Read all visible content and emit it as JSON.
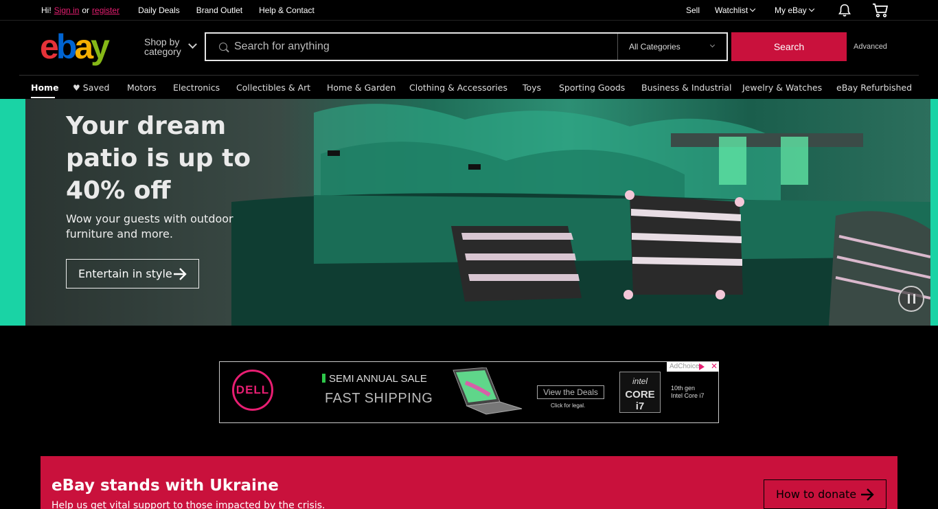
{
  "topbar": {
    "greeting": "Hi!",
    "sign_in": "Sign in",
    "or": "or",
    "register": "register",
    "links": [
      "Daily Deals",
      "Brand Outlet",
      "Help & Contact"
    ],
    "sell": "Sell",
    "watchlist": "Watchlist",
    "my_ebay": "My eBay",
    "notification_icon": "bell-icon",
    "cart_icon": "cart-icon"
  },
  "header": {
    "logo": {
      "e": "e",
      "b": "b",
      "a": "a",
      "y": "y"
    },
    "shop_by_line1": "Shop by",
    "shop_by_line2": "category",
    "search_placeholder": "Search for anything",
    "category_selected": "All Categories",
    "search_button": "Search",
    "advanced": "Advanced"
  },
  "catnav": {
    "items": [
      "Home",
      "Saved",
      "Motors",
      "Electronics",
      "Collectibles & Art",
      "Home & Garden",
      "Clothing & Accessories",
      "Toys",
      "Sporting Goods",
      "Business & Industrial",
      "Jewelry & Watches",
      "eBay Refurbished"
    ],
    "active": "Home"
  },
  "hero": {
    "headline": "Your dream patio is up to 40% off",
    "subtext": "Wow your guests with outdoor furniture and more.",
    "cta": "Entertain in style"
  },
  "ad": {
    "brand": "DELL",
    "sale": "SEMI ANNUAL SALE",
    "shipping": "FAST SHIPPING",
    "deals_button": "View the Deals",
    "legal": "Click for legal.",
    "intel_brand": "intel",
    "intel_chip": "CORE i7",
    "gen_line1": "10th gen",
    "gen_line2": "Intel Core i7",
    "adchoices": "AdChoices"
  },
  "ukraine": {
    "title": "eBay stands with Ukraine",
    "subtitle": "Help us get vital support to those impacted by the crisis.",
    "cta": "How to donate"
  },
  "colors": {
    "accent_red": "#c9113c",
    "hero_stripe": "#1ad3a5",
    "link_pink": "#e81e72"
  }
}
